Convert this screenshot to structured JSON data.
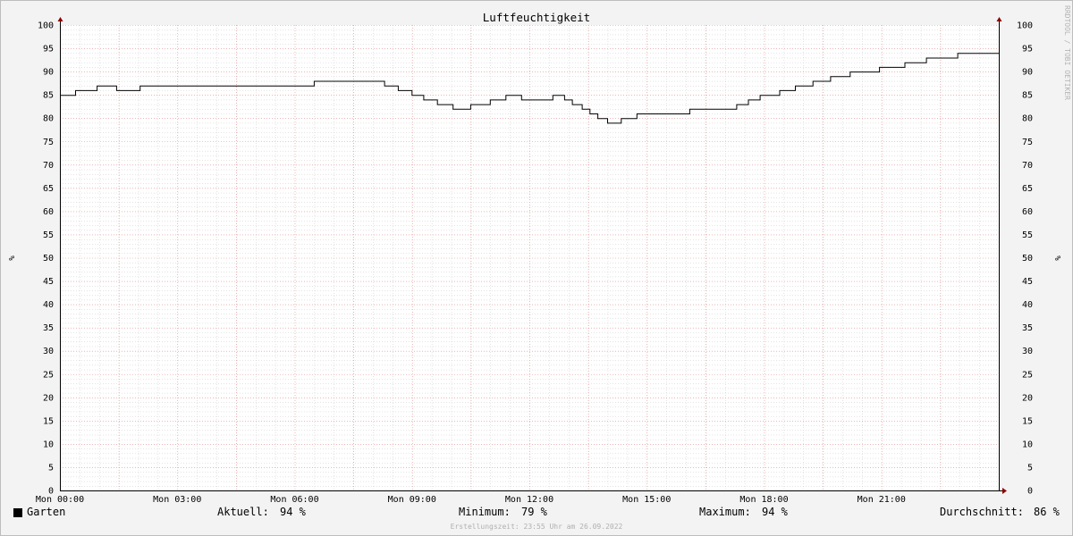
{
  "chart_data": {
    "type": "line",
    "title": "Luftfeuchtigkeit",
    "ylabel": "%",
    "ylabel_right": "%",
    "ylim": [
      0,
      100
    ],
    "yticks": [
      0,
      5,
      10,
      15,
      20,
      25,
      30,
      35,
      40,
      45,
      50,
      55,
      60,
      65,
      70,
      75,
      80,
      85,
      90,
      95,
      100
    ],
    "xlim": [
      0,
      24
    ],
    "xticks": [
      {
        "t": 0,
        "label": "Mon 00:00"
      },
      {
        "t": 3,
        "label": "Mon 03:00"
      },
      {
        "t": 6,
        "label": "Mon 06:00"
      },
      {
        "t": 9,
        "label": "Mon 09:00"
      },
      {
        "t": 12,
        "label": "Mon 12:00"
      },
      {
        "t": 15,
        "label": "Mon 15:00"
      },
      {
        "t": 18,
        "label": "Mon 18:00"
      },
      {
        "t": 21,
        "label": "Mon 21:00"
      }
    ],
    "grid": true,
    "series": [
      {
        "name": "Garten",
        "color": "#000000",
        "x": [
          0.0,
          0.4,
          0.95,
          1.45,
          2.05,
          6.5,
          8.3,
          8.65,
          9.0,
          9.3,
          9.65,
          10.05,
          10.5,
          11.0,
          11.4,
          11.8,
          12.6,
          12.9,
          13.1,
          13.35,
          13.55,
          13.75,
          14.0,
          14.35,
          14.75,
          15.1,
          15.35,
          16.1,
          17.3,
          17.6,
          17.9,
          18.4,
          18.8,
          19.25,
          19.7,
          20.2,
          20.95,
          21.6,
          22.15,
          22.95,
          24.0
        ],
        "y": [
          85,
          86,
          87,
          86,
          87,
          88,
          87,
          86,
          85,
          84,
          83,
          82,
          83,
          84,
          85,
          84,
          85,
          84,
          83,
          82,
          81,
          80,
          79,
          80,
          81,
          81,
          81,
          82,
          83,
          84,
          85,
          86,
          87,
          88,
          89,
          90,
          91,
          92,
          93,
          94,
          94
        ],
        "current": "94 %",
        "minimum": "79 %",
        "maximum": "94 %",
        "average": "86 %"
      }
    ]
  },
  "legend": {
    "series_label": "Garten",
    "current_label": "Aktuell:",
    "current_value": "94 %",
    "min_label": "Minimum:",
    "min_value": "79 %",
    "max_label": "Maximum:",
    "max_value": "94 %",
    "avg_label": "Durchschnitt:",
    "avg_value": "86 %"
  },
  "watermark": "RRDTOOL / TOBI OETIKER",
  "footer": "Erstellungszeit: 23:55 Uhr am 26.09.2022",
  "colors": {
    "background": "#f3f3f3",
    "plot_background": "#ffffff",
    "minor_grid": "#c8c8c8",
    "major_grid": "#e08a8a",
    "axis": "#000000",
    "arrow": "#8b0000",
    "line": "#000000"
  }
}
